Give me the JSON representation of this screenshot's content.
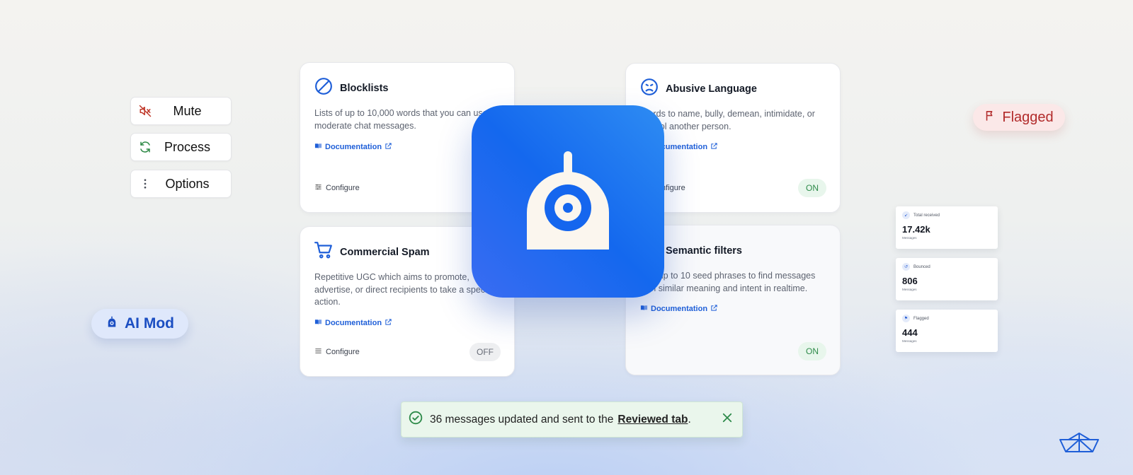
{
  "actions": [
    {
      "label": "Mute",
      "icon": "mute-icon"
    },
    {
      "label": "Process",
      "icon": "refresh-icon"
    },
    {
      "label": "Options",
      "icon": "more-vertical-icon"
    }
  ],
  "cards": {
    "blocklists": {
      "title": "Blocklists",
      "description": "Lists of up to 10,000 words that you can use to moderate chat messages.",
      "doc_label": "Documentation",
      "configure_label": "Configure"
    },
    "abusive": {
      "title": "Abusive Language",
      "description": "Words to name, bully, demean, intimidate, or control another person.",
      "doc_label": "Documentation",
      "configure_label": "Configure",
      "toggle": "ON"
    },
    "spam": {
      "title": "Commercial Spam",
      "description": "Repetitive UGC which aims to promote, advertise, or direct recipients to take a specific action.",
      "doc_label": "Documentation",
      "configure_label": "Configure",
      "toggle": "OFF"
    },
    "semantic": {
      "title": "Semantic filters",
      "description": "Use up to 10 seed phrases to find messages with similar meaning and intent in realtime.",
      "doc_label": "Documentation",
      "toggle": "ON"
    }
  },
  "pills": {
    "flagged": "Flagged",
    "ai_mod": "AI Mod"
  },
  "stats": [
    {
      "label": "Total received",
      "value": "17.42k",
      "unit": "Messages"
    },
    {
      "label": "Bounced",
      "value": "806",
      "unit": "Messages"
    },
    {
      "label": "Flagged",
      "value": "444",
      "unit": "Messages"
    }
  ],
  "toast": {
    "message": "36 messages updated and sent to the",
    "link": "Reviewed tab",
    "suffix": "."
  },
  "colors": {
    "accent": "#1468ee",
    "on_green": "#2d8a49",
    "flag_red": "#b22b2b",
    "link_blue": "#1f5fd8"
  }
}
